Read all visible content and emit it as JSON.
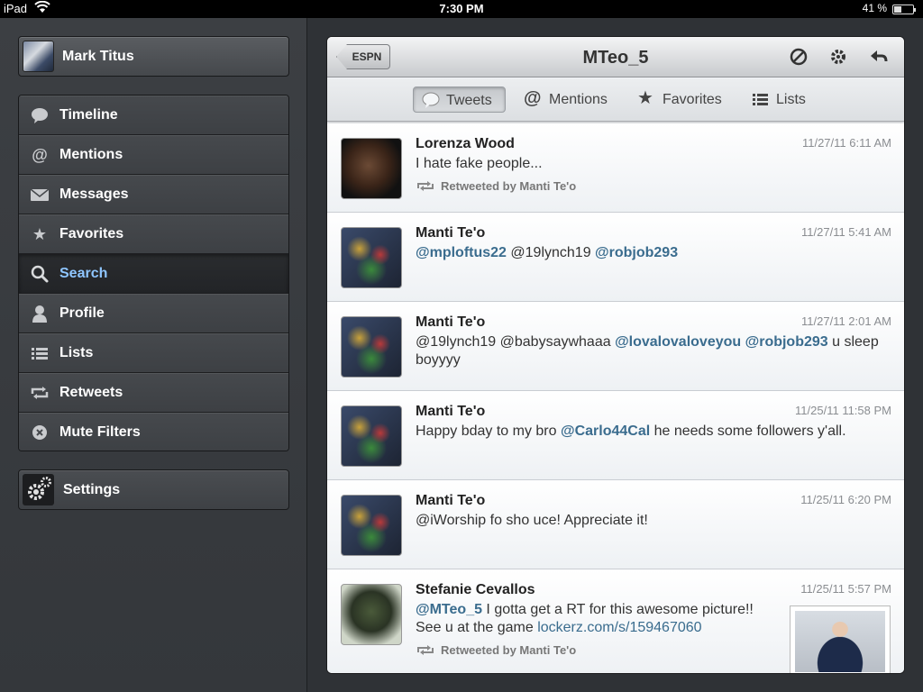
{
  "status_bar": {
    "device": "iPad",
    "time": "7:30 PM",
    "battery": "41 %"
  },
  "sidebar": {
    "account_name": "Mark Titus",
    "menu": [
      {
        "label": "Timeline",
        "icon": "speech-bubble-icon"
      },
      {
        "label": "Mentions",
        "icon": "at-icon"
      },
      {
        "label": "Messages",
        "icon": "envelope-icon"
      },
      {
        "label": "Favorites",
        "icon": "star-icon"
      },
      {
        "label": "Search",
        "icon": "magnifier-icon",
        "active": true
      },
      {
        "label": "Profile",
        "icon": "person-icon"
      },
      {
        "label": "Lists",
        "icon": "list-icon"
      },
      {
        "label": "Retweets",
        "icon": "retweet-icon"
      },
      {
        "label": "Mute Filters",
        "icon": "mute-icon"
      }
    ],
    "settings_label": "Settings"
  },
  "header": {
    "back_label": "ESPN",
    "title": "MTeo_5"
  },
  "segments": {
    "tweets": "Tweets",
    "mentions": "Mentions",
    "favorites": "Favorites",
    "lists": "Lists"
  },
  "tweets": [
    {
      "author": "Lorenza Wood",
      "time": "11/27/11 6:11 AM",
      "body": "I hate fake people...",
      "retweet": "Retweeted by Manti Te'o"
    },
    {
      "author": "Manti Te'o",
      "time": "11/27/11 5:41 AM",
      "m1": "@mploftus22",
      "t1": " @19lynch19 ",
      "m2": "@robjob293"
    },
    {
      "author": "Manti Te'o",
      "time": "11/27/11 2:01 AM",
      "t1": "@19lynch19 @babysaywhaaa ",
      "m1": "@lovalovaloveyou",
      "t2": " ",
      "m2": "@robjob293",
      "t3": " u sleep boyyyy"
    },
    {
      "author": "Manti Te'o",
      "time": "11/25/11 11:58 PM",
      "t1": "Happy bday to my bro ",
      "m1": "@Carlo44Cal",
      "t2": " he needs some followers y'all."
    },
    {
      "author": "Manti Te'o",
      "time": "11/25/11 6:20 PM",
      "body": "@iWorship fo sho uce! Appreciate it!"
    },
    {
      "author": "Stefanie Cevallos",
      "time": "11/25/11 5:57 PM",
      "m1": "@MTeo_5",
      "t1": " I gotta get a RT for this awesome picture!! See u at the game ",
      "link": "lockerz.com/s/159467060",
      "retweet": "Retweeted by Manti Te'o"
    }
  ]
}
